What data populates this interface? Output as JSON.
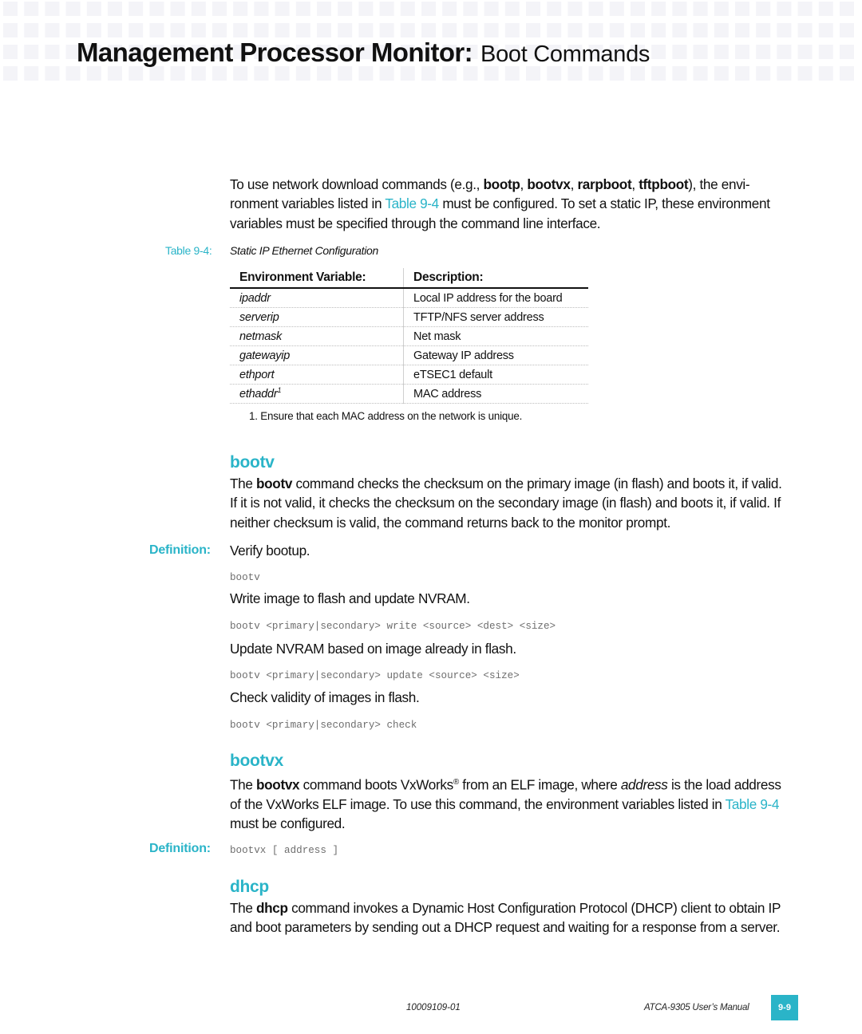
{
  "header": {
    "title_main": "Management Processor Monitor:",
    "title_sub": "Boot Commands"
  },
  "intro": {
    "t1": "To use network download commands (e.g., ",
    "cmd1": "bootp",
    "sep1": ", ",
    "cmd2": "bootvx",
    "sep2": ", ",
    "cmd3": "rarpboot",
    "sep3": ", ",
    "cmd4": "tftpboot",
    "t2": "), the envi­ronment variables listed in ",
    "link": "Table 9-4",
    "t3": " must be configured. To set a static IP, these environ­ment variables must be specified through the command line interface."
  },
  "table": {
    "caption_number": "Table 9-4:",
    "caption_title": "Static IP Ethernet Configuration",
    "headers": [
      "Environment Variable:",
      "Description:"
    ],
    "rows": [
      {
        "variable": "ipaddr",
        "sup": "",
        "description": "Local IP address for the board"
      },
      {
        "variable": "serverip",
        "sup": "",
        "description": "TFTP/NFS server address"
      },
      {
        "variable": "netmask",
        "sup": "",
        "description": "Net mask"
      },
      {
        "variable": "gatewayip",
        "sup": "",
        "description": "Gateway IP address"
      },
      {
        "variable": "ethport",
        "sup": "",
        "description": "eTSEC1 default"
      },
      {
        "variable": "ethaddr",
        "sup": "1",
        "description": "MAC address"
      }
    ],
    "footnote": "1.  Ensure that each MAC address on the network is unique."
  },
  "bootv": {
    "heading": "bootv",
    "p_the": "The ",
    "p_cmd": "bootv",
    "p_rest": " command checks the checksum on the primary image (in flash) and boots it, if valid. If it is not valid, it checks the checksum on the secondary image (in flash) and boots it, if valid. If neither checksum is valid, the command returns back to the monitor prompt.",
    "definition_label": "Definition:",
    "definition_text": "Verify bootup.",
    "code1": "bootv",
    "desc2": "Write image to flash and update NVRAM.",
    "code2": "bootv <primary|secondary> write <source> <dest> <size>",
    "desc3": "Update NVRAM based on image already in flash.",
    "code3": "bootv <primary|secondary> update <source> <size>",
    "desc4": "Check validity of images in flash.",
    "code4": "bootv <primary|secondary> check"
  },
  "bootvx": {
    "heading": "bootvx",
    "p_the": "The ",
    "p_cmd": "bootvx",
    "p_t1": " command boots VxWorks",
    "p_reg": "®",
    "p_t2": " from an ELF image, where ",
    "p_em": "address",
    "p_t3": " is the load address of the VxWorks ELF image. To use this command, the environment variables listed in ",
    "p_link": "Table 9-4",
    "p_t4": " must be configured.",
    "definition_label": "Definition:",
    "definition_code": "bootvx [ address ]"
  },
  "dhcp": {
    "heading": "dhcp",
    "p_the": "The ",
    "p_cmd": "dhcp",
    "p_rest": " command invokes a Dynamic Host Configuration Protocol (DHCP) client to obtain IP and boot parameters by sending out a DHCP request and waiting for a response from a server."
  },
  "footer": {
    "doc_number": "10009109-01",
    "manual_title": "ATCA-9305 User’s Manual",
    "page_number": "9-9"
  },
  "colors": {
    "accent": "#2ab4c8",
    "header_grid": "#f4f4f8",
    "code_text": "#6e6e6e"
  }
}
